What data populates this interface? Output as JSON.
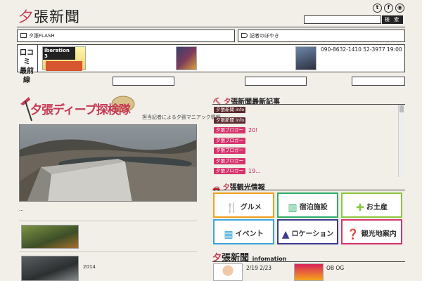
{
  "header": {
    "logo_kana": "夕",
    "logo_rest": "張新聞",
    "social": [
      "twitter-icon",
      "facebook-icon",
      "rss-icon"
    ],
    "search_placeholder": "",
    "search_button": "検 索"
  },
  "flash": {
    "label": "夕張FLASH",
    "label_value": "",
    "bloggers_label": "記者のぼやき",
    "bloggers_value": ""
  },
  "kuchikomi": {
    "label_line1": "口コミ",
    "label_line2": "最前線",
    "items": [
      {
        "thumb_text": "iberation 3",
        "text": ""
      },
      {
        "thumb_text": "",
        "text": ""
      },
      {
        "thumb_text": "",
        "text": "090-8632-1410 52-3977 19:00"
      }
    ],
    "more_label": ""
  },
  "feature": {
    "banner_text": "夕張ディープ探検隊",
    "subtitle": "担当記者による夕張マニアック情報",
    "photo_caption": "",
    "caption": "...",
    "more": "",
    "list": [
      {
        "title": "",
        "desc": ""
      },
      {
        "title": "",
        "desc": "2014"
      }
    ]
  },
  "latest": {
    "title_accent": "夕",
    "title_rest": "張新聞最新記事",
    "items": [
      {
        "tag": "夕張新聞 info",
        "tag_color": "#5b2a2e",
        "headline": ""
      },
      {
        "tag": "夕張新聞 info",
        "tag_color": "#5b2a2e",
        "headline": ""
      },
      {
        "tag": "夕張ブロガーズ",
        "tag_color": "#d6336c",
        "headline": "20!"
      },
      {
        "tag": "夕張ブロガーズ",
        "tag_color": "#d6336c",
        "headline": ""
      },
      {
        "tag": "夕張ブロガーズ",
        "tag_color": "#d6336c",
        "headline": ""
      },
      {
        "tag": "夕張ブロガーズ",
        "tag_color": "#d6336c",
        "headline": ""
      },
      {
        "tag": "夕張ブロガーズ",
        "tag_color": "#d6336c",
        "headline": "19..."
      }
    ]
  },
  "kanko": {
    "title_accent": "夕",
    "title_rest": "張観光情報",
    "buttons": [
      {
        "label": "グルメ",
        "color": "#f0a020",
        "icon": "fork-knife-icon",
        "glyph": "🍴"
      },
      {
        "label": "宿泊施設",
        "color": "#2eae6a",
        "icon": "building-icon",
        "glyph": "▥"
      },
      {
        "label": "お土産",
        "color": "#8cc63f",
        "icon": "gift-icon",
        "glyph": "✚"
      },
      {
        "label": "イベント",
        "color": "#3aa6dd",
        "icon": "calendar-icon",
        "glyph": "▦"
      },
      {
        "label": "ロケーション",
        "color": "#3b3b8f",
        "icon": "mountain-icon",
        "glyph": "▲"
      },
      {
        "label": "観光地案内",
        "color": "#d6336c",
        "icon": "info-icon",
        "glyph": "❓"
      }
    ]
  },
  "information": {
    "title_accent": "夕",
    "title_rest": "張新聞",
    "title_small": "infomation",
    "items": [
      {
        "text": "2/19 2/23"
      },
      {
        "text": "OB OG"
      }
    ]
  }
}
